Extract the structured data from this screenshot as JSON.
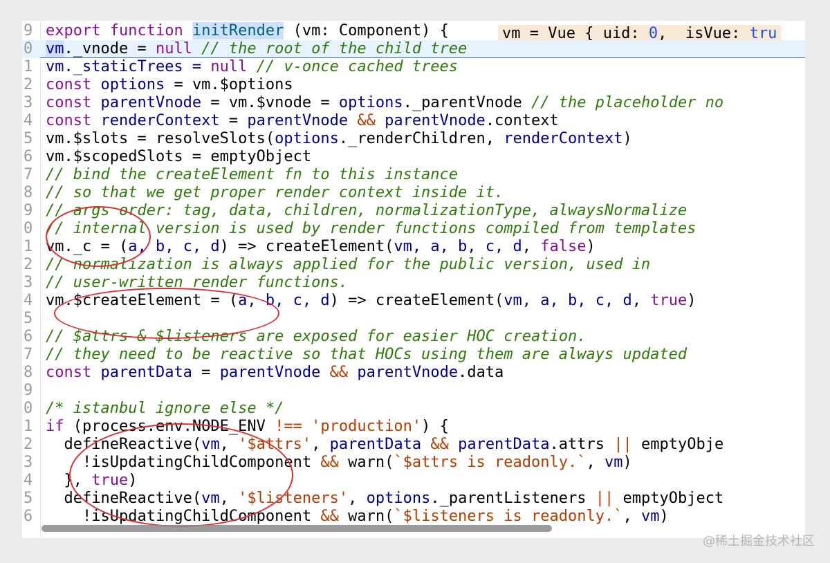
{
  "editor": {
    "inline_hint": {
      "prefix": "vm = Vue {_uid: ",
      "uid": "0",
      "middle": ", _isVue: ",
      "tail": "tru"
    },
    "lines": [
      {
        "num": "9"
      },
      {
        "num": "0"
      },
      {
        "num": "1"
      },
      {
        "num": "2"
      },
      {
        "num": "3"
      },
      {
        "num": "4"
      },
      {
        "num": "5"
      },
      {
        "num": "6"
      },
      {
        "num": "7"
      },
      {
        "num": "8"
      },
      {
        "num": "9"
      },
      {
        "num": "0"
      },
      {
        "num": "1"
      },
      {
        "num": "2"
      },
      {
        "num": "3"
      },
      {
        "num": "4"
      },
      {
        "num": "5"
      },
      {
        "num": "6"
      },
      {
        "num": "7"
      },
      {
        "num": "8"
      },
      {
        "num": "9"
      },
      {
        "num": "0"
      },
      {
        "num": "1"
      },
      {
        "num": "2"
      },
      {
        "num": "3"
      },
      {
        "num": "4"
      },
      {
        "num": "5"
      },
      {
        "num": "6"
      }
    ]
  },
  "code": {
    "l0": {
      "export": "export",
      "function": "function",
      "name": "initRender",
      "params": " (vm: Component) {"
    },
    "l1": {
      "vm": "vm",
      "rest": "._vnode = ",
      "null": "null",
      "comment": " // the root of the child tree"
    },
    "l2": {
      "a": "vm._staticTrees = ",
      "null": "null",
      "comment": " // v-once cached trees"
    },
    "l3": {
      "const": "const",
      "name": " options",
      "rest": " = vm.$options"
    },
    "l4": {
      "const": "const",
      "name": " parentVnode",
      "eq": " = vm.$vnode = ",
      "opt": "options",
      "rest": "._parentVnode",
      "comment": " // the placeholder no"
    },
    "l5": {
      "const": "const",
      "name": " renderContext",
      "eq": " = ",
      "pv": "parentVnode",
      "and": " && ",
      "pv2": "parentVnode",
      "rest": ".context"
    },
    "l6": {
      "a": "vm.$slots = resolveSlots(",
      "opt": "options",
      "b": "._renderChildren, ",
      "rc": "renderContext",
      "c": ")"
    },
    "l7": {
      "a": "vm.$scopedSlots = emptyObject"
    },
    "l8": {
      "comment": "// bind the createElement fn to this instance"
    },
    "l9": {
      "comment": "// so that we get proper render context inside it."
    },
    "l10": {
      "comment": "// args order: tag, data, children, normalizationType, alwaysNormalize"
    },
    "l11": {
      "comment": "// internal version is used by render functions compiled from templates"
    },
    "l12": {
      "a": "vm._c = (",
      "args": "a, b, c, d",
      "b": ") => createElement(",
      "args2": "vm, a, b, c, d",
      "sep": ", ",
      "bool": "false",
      "c": ")"
    },
    "l13": {
      "comment": "// normalization is always applied for the public version, used in"
    },
    "l14": {
      "comment": "// user-written render functions."
    },
    "l15": {
      "a": "vm.$createElement = (",
      "args": "a, b, c, d",
      "b": ") => createElement(",
      "args2": "vm, a, b, c, d",
      "sep": ", ",
      "bool": "true",
      "c": ")"
    },
    "l16": {},
    "l17": {
      "comment": "// $attrs & $listeners are exposed for easier HOC creation."
    },
    "l18": {
      "comment": "// they need to be reactive so that HOCs using them are always updated"
    },
    "l19": {
      "const": "const",
      "name": " parentData",
      "eq": " = ",
      "pv": "parentVnode",
      "and": " && ",
      "pv2": "parentVnode",
      "rest": ".data"
    },
    "l20": {},
    "l21": {
      "comment": "/* istanbul ignore else */"
    },
    "l22": {
      "if": "if",
      "a": " (process.env.NODE_ENV ",
      "op": "!==",
      "sp": " ",
      "str": "'production'",
      "b": ") {"
    },
    "l23": {
      "a": "  defineReactive(",
      "vm": "vm",
      "sep": ", ",
      "str": "'$attrs'",
      "sep2": ", ",
      "pd": "parentData",
      "and": " && ",
      "pd2": "parentData",
      "b": ".attrs ",
      "or": "||",
      "c": " emptyObje"
    },
    "l24": {
      "a": "    !isUpdatingChildComponent ",
      "and": "&&",
      "b": " warn(",
      "str": "`$attrs is readonly.`",
      "sep": ", ",
      "vm": "vm",
      "c": ")"
    },
    "l25": {
      "a": "  }, ",
      "bool": "true",
      "b": ")"
    },
    "l26": {
      "a": "  defineReactive(",
      "vm": "vm",
      "sep": ", ",
      "str": "'$listeners'",
      "sep2": ", ",
      "opt": "options",
      "b": "._parentListeners ",
      "or": "||",
      "c": " emptyObject"
    },
    "l27": {
      "a": "    !isUpdatingChildComponent ",
      "and": "&&",
      "b": " warn(",
      "str": "`$listeners is readonly.`",
      "sep": ", ",
      "vm": "vm",
      "c": ")"
    }
  },
  "watermark": "@稀土掘金技术社区",
  "colors": {
    "keyword": "#0033b3",
    "comment": "#2f7a0b",
    "string": "#b33e00",
    "variable": "#00008b",
    "highlight_line": "#e8f2fe",
    "annotation": "#d83030"
  }
}
